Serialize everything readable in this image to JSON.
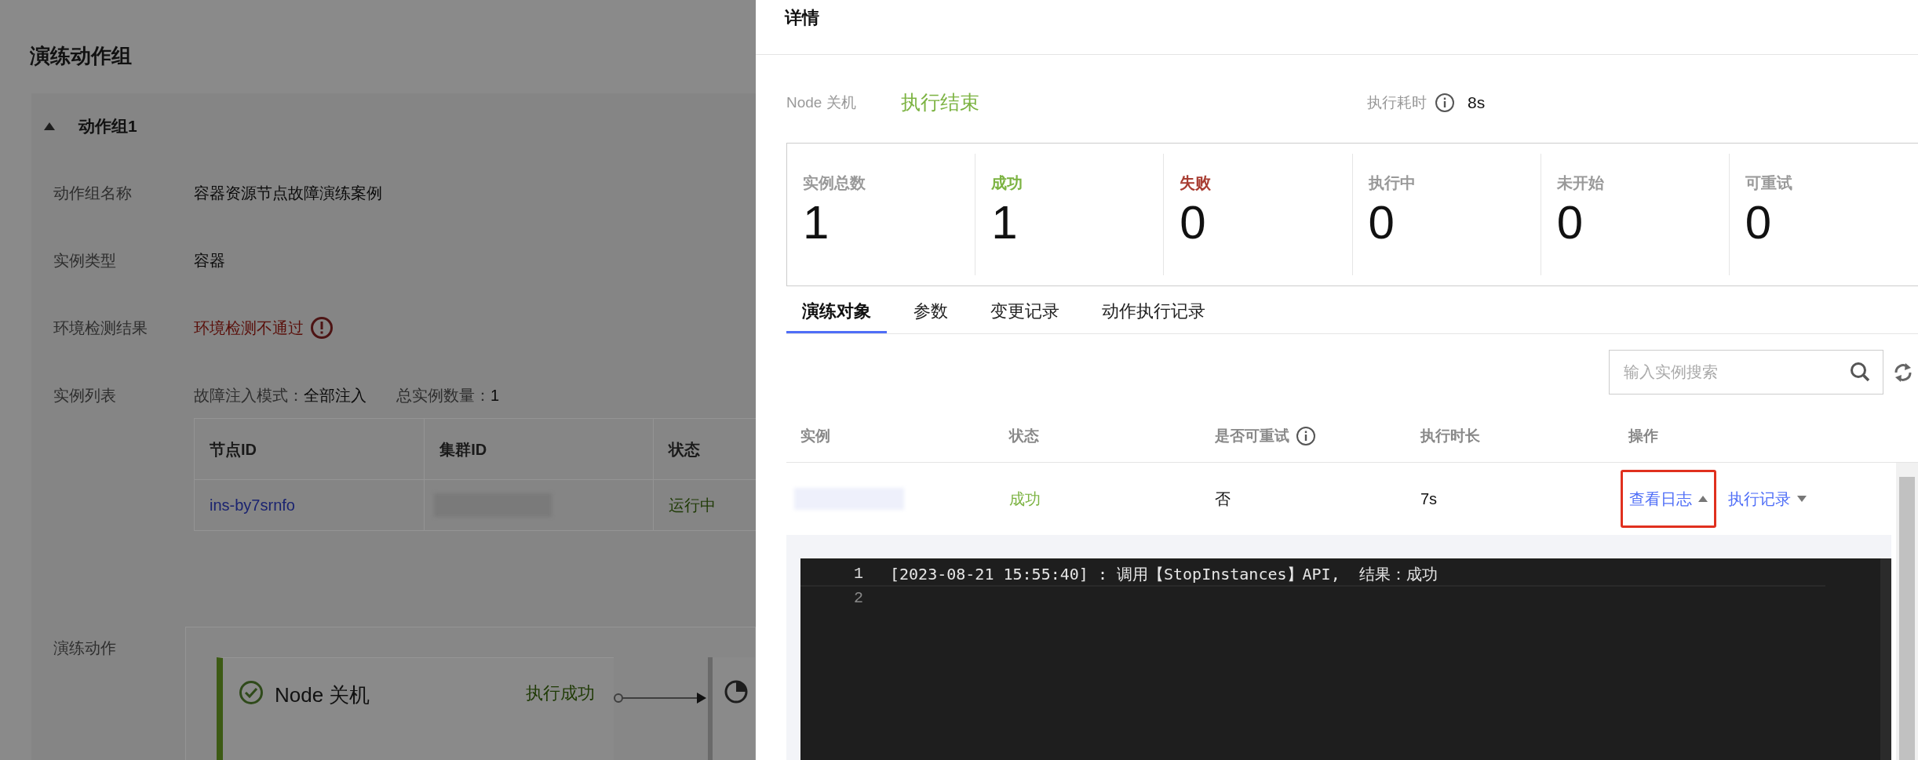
{
  "background_page": {
    "title": "演练动作组",
    "group": {
      "name": "动作组1",
      "expanded": true,
      "fields": [
        {
          "kind": "text",
          "label": "动作组名称",
          "value": "容器资源节点故障演练案例"
        },
        {
          "kind": "text",
          "label": "实例类型",
          "value": "容器"
        },
        {
          "kind": "error",
          "label": "环境检测结果",
          "value": "环境检测不通过"
        },
        {
          "kind": "instances",
          "label": "实例列表",
          "mode_label": "故障注入模式：",
          "mode_value": "全部注入",
          "count_label": "总实例数量：",
          "count_value": "1"
        }
      ],
      "table": {
        "columns": [
          "节点ID",
          "集群ID",
          "状态"
        ],
        "rows": [
          {
            "node_id": "ins-by7srnfo",
            "status": "运行中"
          }
        ]
      },
      "actions_label": "演练动作",
      "actions": [
        {
          "name": "Node 关机",
          "status": "执行成功"
        }
      ]
    }
  },
  "drawer": {
    "title": "详情",
    "action_name": "Node 关机",
    "result": "执行结束",
    "duration_label": "执行耗时",
    "duration": "8s",
    "stats": [
      {
        "label": "实例总数",
        "value": "1",
        "color": "#999999"
      },
      {
        "label": "成功",
        "value": "1",
        "color": "#7cb342"
      },
      {
        "label": "失败",
        "value": "0",
        "color": "#a83d32"
      },
      {
        "label": "执行中",
        "value": "0",
        "color": "#999999"
      },
      {
        "label": "未开始",
        "value": "0",
        "color": "#999999"
      },
      {
        "label": "可重试",
        "value": "0",
        "color": "#999999"
      }
    ],
    "tabs": [
      {
        "label": "演练对象",
        "selected": true
      },
      {
        "label": "参数",
        "selected": false
      },
      {
        "label": "变更记录",
        "selected": false
      },
      {
        "label": "动作执行记录",
        "selected": false
      }
    ],
    "search": {
      "placeholder": "输入实例搜索"
    },
    "table": {
      "columns": [
        "实例",
        "状态",
        "是否可重试",
        "执行时长",
        "操作"
      ],
      "rows": [
        {
          "status": "成功",
          "retryable": "否",
          "duration": "7s",
          "operations": [
            {
              "label": "查看日志",
              "expanded": true,
              "highlighted": true
            },
            {
              "label": "执行记录",
              "expanded": false,
              "highlighted": false
            }
          ]
        }
      ]
    },
    "log": [
      {
        "number": "1",
        "text": "[2023-08-21 15:55:40] : 调用【StopInstances】API,  结果：成功"
      },
      {
        "number": "2"
      }
    ]
  }
}
